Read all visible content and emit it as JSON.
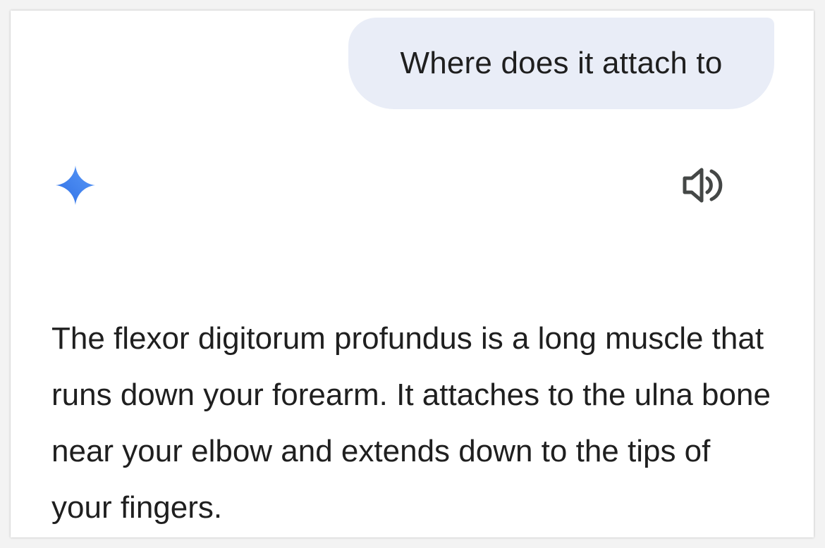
{
  "conversation": {
    "user_message": "Where does it attach to",
    "assistant_response": "The flexor digitorum profundus is a long muscle that runs down your forearm. It attaches to the ulna bone near your elbow and extends down to the tips of your fingers."
  },
  "icons": {
    "assistant_avatar": "sparkle-icon",
    "read_aloud": "speaker-icon"
  },
  "colors": {
    "user_bubble_bg": "#e9edf7",
    "sparkle_gradient_start": "#4e8cf6",
    "sparkle_gradient_end": "#2f6fe4",
    "text": "#1f1f1f",
    "icon": "#444746"
  }
}
